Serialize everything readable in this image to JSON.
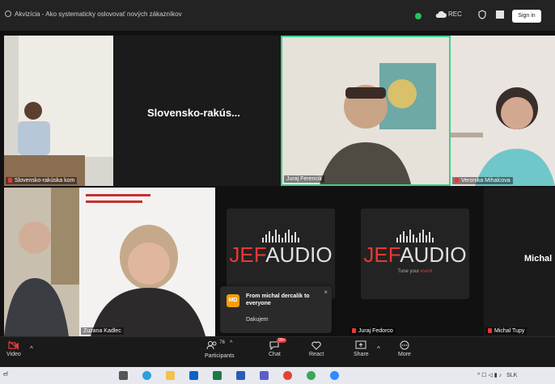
{
  "window": {
    "title": "Akvizícia - Ako systematicky oslovovať nových zákazníkov",
    "rec_label": "REC",
    "signin_label": "Sign in",
    "rec_color": "#22c55e"
  },
  "tiles": {
    "speaker1": {
      "name": "Slovensko-rakúska kom"
    },
    "slovensko_banner": "Slovensko-rakús...",
    "juraj_ferencik": {
      "name": "Juraj Ferencik"
    },
    "veronika": {
      "name": "Veronika Mihalcova"
    },
    "zuzana": {
      "name": "Zuzana Kadlec"
    },
    "jef1": {
      "logo_je": "JEF",
      "logo_audio": "AUDIO"
    },
    "jef2": {
      "logo_je": "JEF",
      "logo_audio": "AUDIO",
      "tagline_left": "Tune your",
      "tagline_right": "event"
    },
    "juraj_fedorco": {
      "name": "Juraj Fedorco"
    },
    "michal": {
      "banner": "Michal",
      "name": "Michal Tupy"
    }
  },
  "chat_popup": {
    "avatar": "MD",
    "from": "From michal dercalik to everyone",
    "message": "Dakujem",
    "close": "×"
  },
  "toolbar": {
    "video": "Video",
    "participants": "Participants",
    "participants_count": "76",
    "chat": "Chat",
    "chat_badge": "99+",
    "react": "React",
    "share": "Share",
    "more": "More"
  },
  "taskbar": {
    "left_text": "ef",
    "tray_text": "SLK",
    "accent": "#0078d4"
  }
}
